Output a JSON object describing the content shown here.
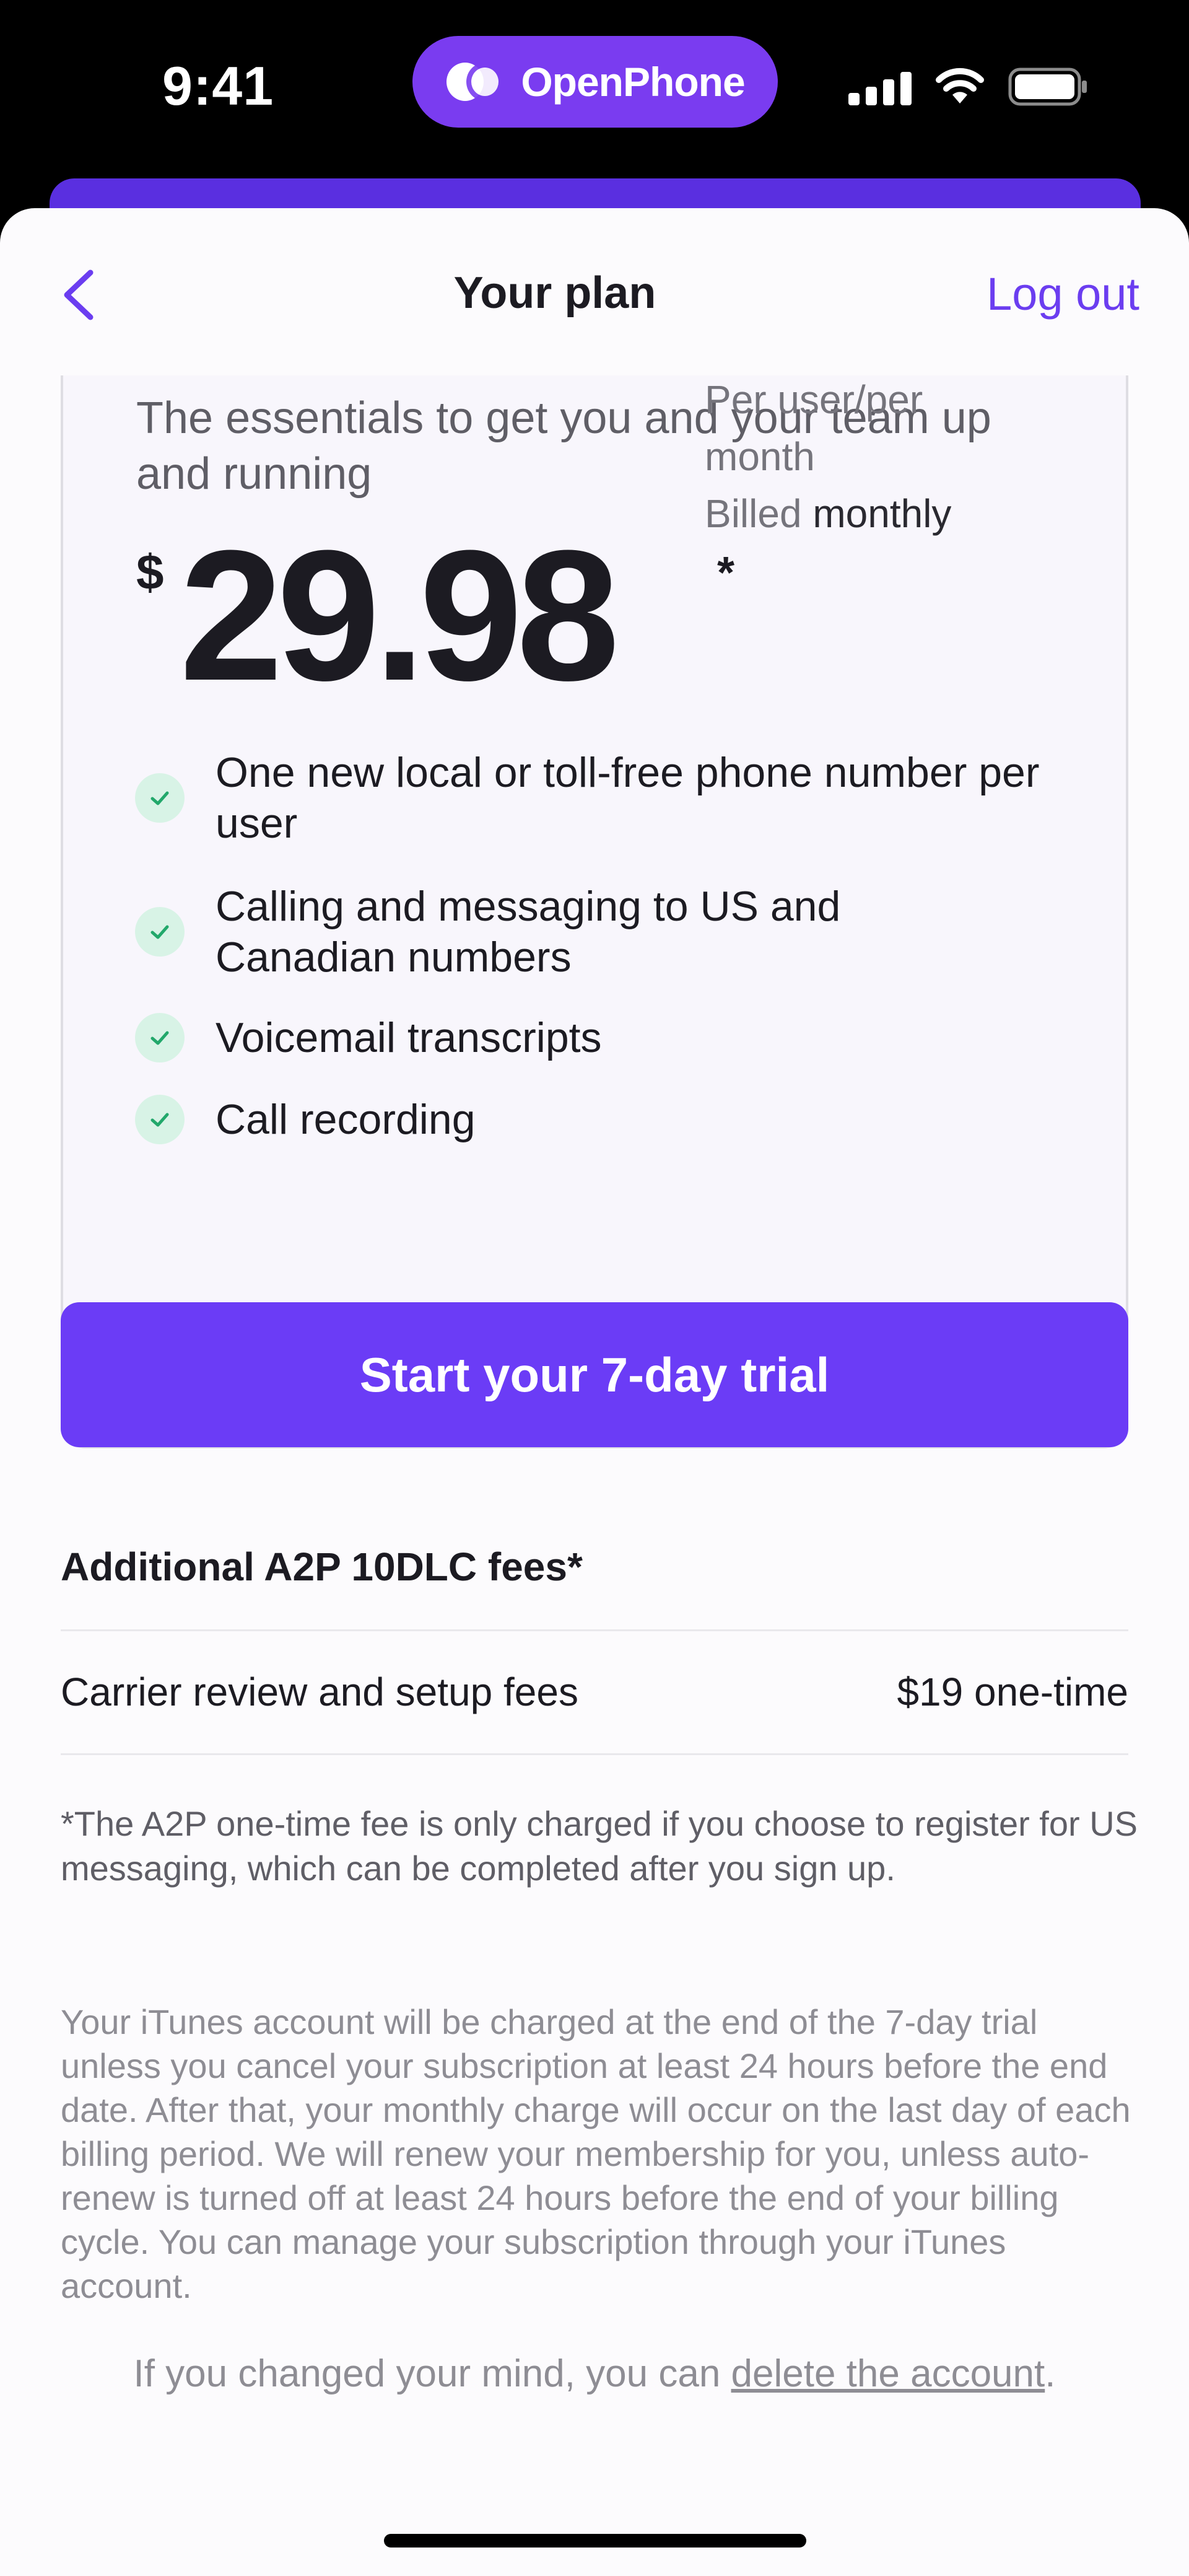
{
  "status_bar": {
    "time": "9:41",
    "island_brand": "OpenPhone",
    "icons": [
      "cellular-signal-icon",
      "wifi-icon",
      "battery-icon"
    ]
  },
  "nav": {
    "title": "Your plan",
    "logout_label": "Log out",
    "back_icon": "chevron-left-icon"
  },
  "plan": {
    "description": "The essentials to get you and your team up and running",
    "currency": "$",
    "price": "29.98",
    "asterisk": "*",
    "meta_line1": "Per user/per",
    "meta_line2": "month",
    "meta_billed": "Billed",
    "meta_cycle": "monthly",
    "features": [
      "One new local or toll-free phone number per user",
      "Calling and messaging to US and Canadian numbers",
      "Voicemail transcripts",
      "Call recording"
    ]
  },
  "cta_label": "Start your 7-day trial",
  "fees": {
    "title": "Additional A2P 10DLC fees*",
    "rows": [
      {
        "label": "Carrier review and setup fees",
        "value": "$19 one-time"
      }
    ]
  },
  "note": "*The A2P one-time fee is only charged if you choose to register for US messaging, which can be completed after you sign up.",
  "legal": "Your iTunes account will be charged at the end of the 7-day trial unless you cancel your subscription at least 24 hours before the end date. After that, your monthly charge will occur on the last day of each billing period. We will renew your membership for you, unless auto-renew is turned off at least 24 hours before the end of your billing cycle. You can manage your subscription through your iTunes account.",
  "delete": {
    "prefix": "If you changed your mind, you can ",
    "link": "delete the account",
    "suffix": "."
  },
  "colors": {
    "accent": "#6b3cf6",
    "island": "#7a3cf0",
    "check_bg": "#d8f3e6",
    "check_mark": "#22a86b"
  }
}
